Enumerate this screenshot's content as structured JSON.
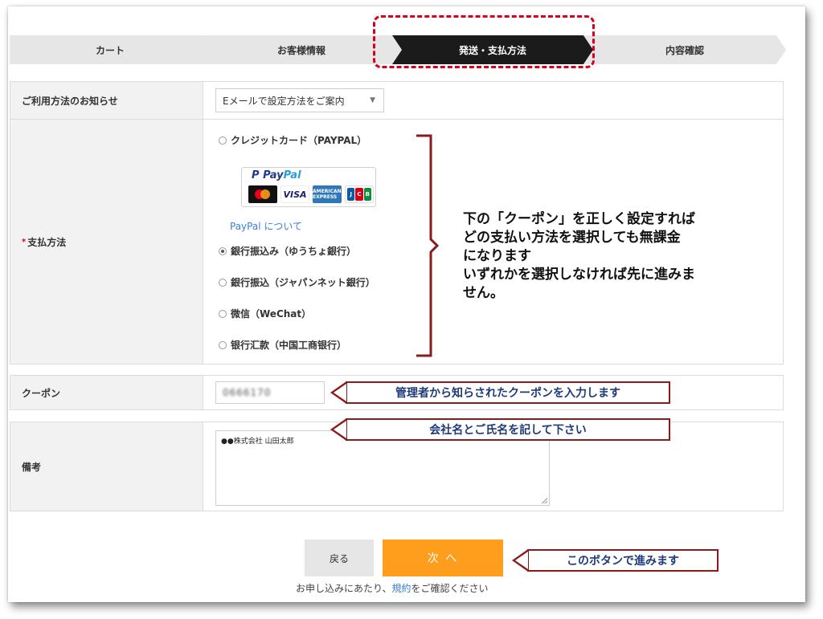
{
  "steps": [
    "カート",
    "お客様情報",
    "発送・支払方法",
    "内容確認"
  ],
  "active_step_index": 2,
  "notice": {
    "label": "ご利用方法のお知らせ",
    "selected": "Eメールで設定方法をご案内"
  },
  "payment": {
    "required_mark": "*",
    "label": "支払方法",
    "options": [
      {
        "label": "クレジットカード（PAYPAL）",
        "checked": false
      },
      {
        "label": "銀行振込み（ゆうちょ銀行）",
        "checked": true
      },
      {
        "label": "銀行振込（ジャパンネット銀行）",
        "checked": false
      },
      {
        "label": "微信（WeChat）",
        "checked": false
      },
      {
        "label": "银行汇款（中国工商银行）",
        "checked": false
      }
    ],
    "paypal_logo_a": "Pay",
    "paypal_logo_b": "Pal",
    "card_visa": "VISA",
    "card_amex": "AMERICAN EXPRESS",
    "card_jcb": [
      "J",
      "C",
      "B"
    ],
    "paypal_link": "PayPal について"
  },
  "annotation_payment": [
    "下の「クーポン」を正しく設定すれば",
    "どの支払い方法を選択しても無課金",
    "になります",
    "いずれかを選択しなければ先に進みま",
    "せん。"
  ],
  "coupon": {
    "label": "クーポン",
    "value": "0666170",
    "callout": "管理者から知らされたクーポンを入力します"
  },
  "remarks": {
    "label": "備考",
    "value": "●●株式会社 山田太郎",
    "callout": "会社名とご氏名を記して下さい"
  },
  "buttons": {
    "back": "戻る",
    "next": "次 へ",
    "next_callout": "このボタンで進みます"
  },
  "terms": {
    "before": "お申し込みにあたり、",
    "link": "規約",
    "after": "をご確認ください"
  },
  "colors": {
    "accent_orange": "#ff9d1c",
    "highlight_red": "#d6001c",
    "callout_border": "#8b1a1a",
    "callout_text": "#1f3a7a",
    "active_step": "#1b1b1b"
  }
}
